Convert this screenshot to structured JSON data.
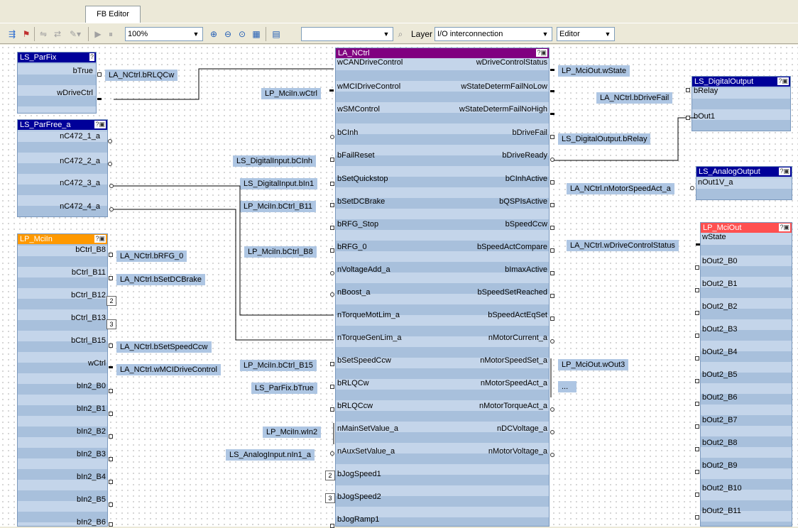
{
  "tab": {
    "label": "FB Editor"
  },
  "toolbar": {
    "zoom": "100%",
    "search_value": "",
    "layer_label": "Layer",
    "layer_value": "I/O interconnection",
    "mode_value": "Editor"
  },
  "colors": {
    "title_dark": "#000099",
    "title_purple": "#800080",
    "title_orange": "#ff9900",
    "title_red": "#ff5050",
    "block_fill": "#a8c0dc"
  },
  "blocks": {
    "parfix": {
      "title": "LS_ParFix",
      "outputs": [
        "bTrue",
        "wDriveCtrl"
      ]
    },
    "parfree": {
      "title": "LS_ParFree_a",
      "outputs": [
        "nC472_1_a",
        "nC472_2_a",
        "nC472_3_a",
        "nC472_4_a"
      ]
    },
    "mciin": {
      "title": "LP_MciIn",
      "outputs": [
        "bCtrl_B8",
        "bCtrl_B11",
        "bCtrl_B12",
        "bCtrl_B13",
        "bCtrl_B15",
        "wCtrl",
        "bIn2_B0",
        "bIn2_B1",
        "bIn2_B2",
        "bIn2_B3",
        "bIn2_B4",
        "bIn2_B5",
        "bIn2_B6"
      ]
    },
    "nctrl": {
      "title": "LA_NCtrl",
      "inputs": [
        "wCANDriveControl",
        "wMCIDriveControl",
        "wSMControl",
        "bCInh",
        "bFailReset",
        "bSetQuickstop",
        "bSetDCBrake",
        "bRFG_Stop",
        "bRFG_0",
        "nVoltageAdd_a",
        "nBoost_a",
        "nTorqueMotLim_a",
        "nTorqueGenLim_a",
        "bSetSpeedCcw",
        "bRLQCw",
        "bRLQCcw",
        "nMainSetValue_a",
        "nAuxSetValue_a",
        "bJogSpeed1",
        "bJogSpeed2",
        "bJogRamp1"
      ],
      "outputs": [
        "wDriveControlStatus",
        "wStateDetermFailNoLow",
        "wStateDetermFailNoHigh",
        "bDriveFail",
        "bDriveReady",
        "bCInhActive",
        "bQSPIsActive",
        "bSpeedCcw",
        "bSpeedActCompare",
        "bImaxActive",
        "bSpeedSetReached",
        "bSpeedActEqSet",
        "nMotorCurrent_a",
        "nMotorSpeedSet_a",
        "nMotorSpeedAct_a",
        "nMotorTorqueAct_a",
        "nDCVoltage_a",
        "nMotorVoltage_a"
      ]
    },
    "digout": {
      "title": "LS_DigitalOutput",
      "inputs": [
        "bRelay",
        "bOut1"
      ]
    },
    "anaout": {
      "title": "LS_AnalogOutput",
      "inputs": [
        "nOut1V_a"
      ]
    },
    "mciout": {
      "title": "LP_MciOut",
      "inputs": [
        "wState",
        "bOut2_B0",
        "bOut2_B1",
        "bOut2_B2",
        "bOut2_B3",
        "bOut2_B4",
        "bOut2_B5",
        "bOut2_B6",
        "bOut2_B7",
        "bOut2_B8",
        "bOut2_B9",
        "bOut2_B10",
        "bOut2_B11"
      ]
    }
  },
  "connectors": {
    "parfix_btrue": "LA_NCtrl.bRLQCw",
    "mciin_b8": "LA_NCtrl.bRFG_0",
    "mciin_b11": "LA_NCtrl.bSetDCBrake",
    "mciin_b15": "LA_NCtrl.bSetSpeedCcw",
    "mciin_wctrl": "LA_NCtrl.wMCIDriveControl",
    "in_wmci": "LP_MciIn.wCtrl",
    "in_bcinh": "LS_DigitalInput.bCInh",
    "in_bfailreset": "LS_DigitalInput.bIn1",
    "in_bsetdcbrake": "LP_MciIn.bCtrl_B11",
    "in_brfg0": "LP_MciIn.bCtrl_B8",
    "in_bsetspeedccw": "LP_MciIn.bCtrl_B15",
    "in_brlqcw": "LS_ParFix.bTrue",
    "in_nmainset": "LP_MciIn.wIn2",
    "in_nauxset": "LS_AnalogInput.nIn1_a",
    "out_wdrivestatus": "LP_MciOut.wState",
    "out_bdrivefail": "LS_DigitalOutput.bRelay",
    "out_nspeedset": "LP_MciOut.wOut3",
    "out_more": "...",
    "do_brelay": "LA_NCtrl.bDriveFail",
    "ao_nout1v": "LA_NCtrl.nMotorSpeedAct_a",
    "mo_wstate": "LA_NCtrl.wDriveControlStatus"
  },
  "badges": {
    "b12": "2",
    "b13": "3",
    "jog1": "2",
    "jog2": "3"
  }
}
